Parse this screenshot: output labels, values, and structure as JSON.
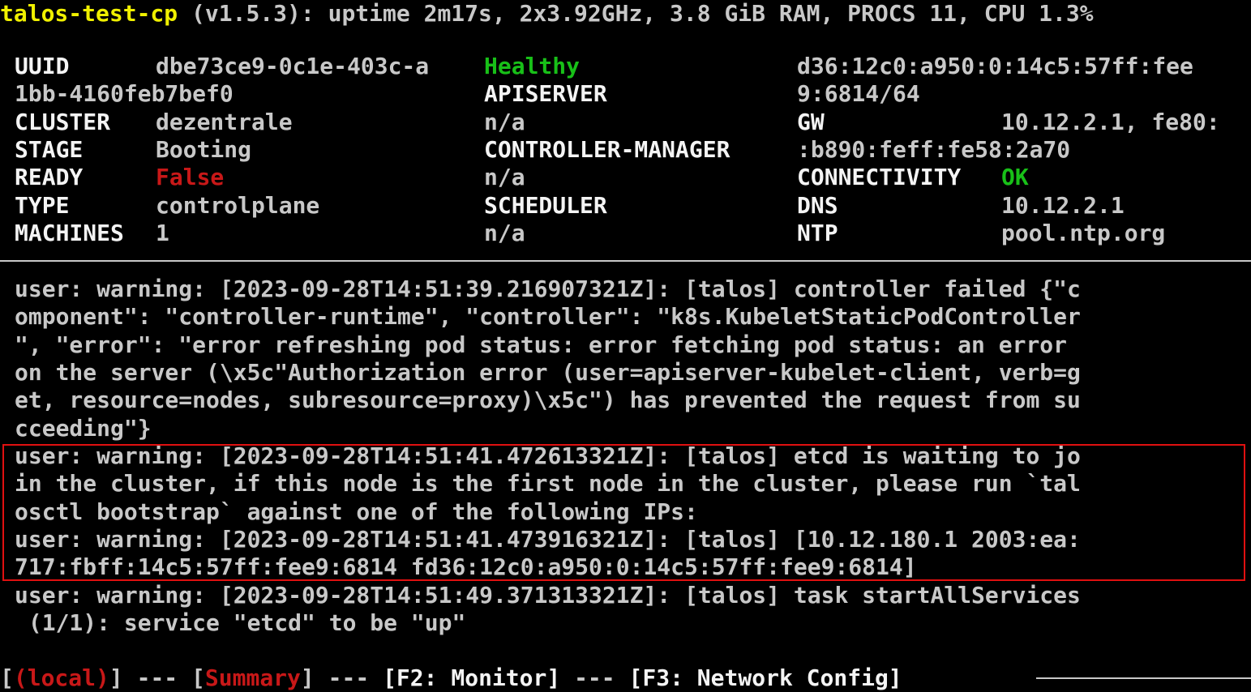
{
  "header": {
    "hostname": "talos-test-cp",
    "info": " (v1.5.3): uptime 2m17s, 2x3.92GHz, 3.8 GiB RAM, PROCS 11, CPU 1.3%"
  },
  "summary": {
    "uuid_label": "UUID",
    "uuid_value_1": "dbe73ce9-0c1e-403c-a",
    "uuid_value_2": "1bb-4160feb7bef0",
    "cluster_label": "CLUSTER",
    "cluster_value": "dezentrale",
    "stage_label": "STAGE",
    "stage_value": "Booting",
    "ready_label": "READY",
    "ready_value": "False",
    "type_label": "TYPE",
    "type_value": "controlplane",
    "machines_label": "MACHINES",
    "machines_value": "1"
  },
  "components": {
    "health": "Healthy",
    "apiserver_label": "APISERVER",
    "apiserver_value": "n/a",
    "controller_manager_label": "CONTROLLER-MANAGER",
    "controller_manager_value": "n/a",
    "scheduler_label": "SCHEDULER",
    "scheduler_value": "n/a"
  },
  "network": {
    "addr_line_1": "d36:12c0:a950:0:14c5:57ff:fee",
    "addr_line_2": "9:6814/64",
    "gw_label": "GW",
    "gw_value_1": "10.12.2.1, fe80:",
    "gw_value_2": ":b890:feff:fe58:2a70",
    "connectivity_label": "CONNECTIVITY",
    "connectivity_value": "OK",
    "dns_label": "DNS",
    "dns_value": "10.12.2.1",
    "ntp_label": "NTP",
    "ntp_value": "pool.ntp.org"
  },
  "logs": [
    "user: warning: [2023-09-28T14:51:39.216907321Z]: [talos] controller failed {\"c",
    "omponent\": \"controller-runtime\", \"controller\": \"k8s.KubeletStaticPodController",
    "\", \"error\": \"error refreshing pod status: error fetching pod status: an error",
    "on the server (\\x5c\"Authorization error (user=apiserver-kubelet-client, verb=g",
    "et, resource=nodes, subresource=proxy)\\x5c\") has prevented the request from su",
    "cceeding\"}",
    "user: warning: [2023-09-28T14:51:41.472613321Z]: [talos] etcd is waiting to jo",
    "in the cluster, if this node is the first node in the cluster, please run `tal",
    "osctl bootstrap` against one of the following IPs:",
    "user: warning: [2023-09-28T14:51:41.473916321Z]: [talos] [10.12.180.1 2003:ea:",
    "717:fbff:14c5:57ff:fee9:6814 fd36:12c0:a950:0:14c5:57ff:fee9:6814]",
    "user: warning: [2023-09-28T14:51:49.371313321Z]: [talos] task startAllServices",
    " (1/1): service \"etcd\" to be \"up\""
  ],
  "footer": {
    "open_bracket": "[",
    "local_label": "(local)",
    "sep1": "] --- [",
    "summary_label": "Summary",
    "sep2": "] --- ",
    "monitor_label": "[F2: Monitor]",
    "sep3": " --- ",
    "network_label": "[F3: Network Config]"
  },
  "colors": {
    "hostname": "#f0f000",
    "healthy": "#18c018",
    "false": "#c81818",
    "highlight_border": "#e01010"
  }
}
